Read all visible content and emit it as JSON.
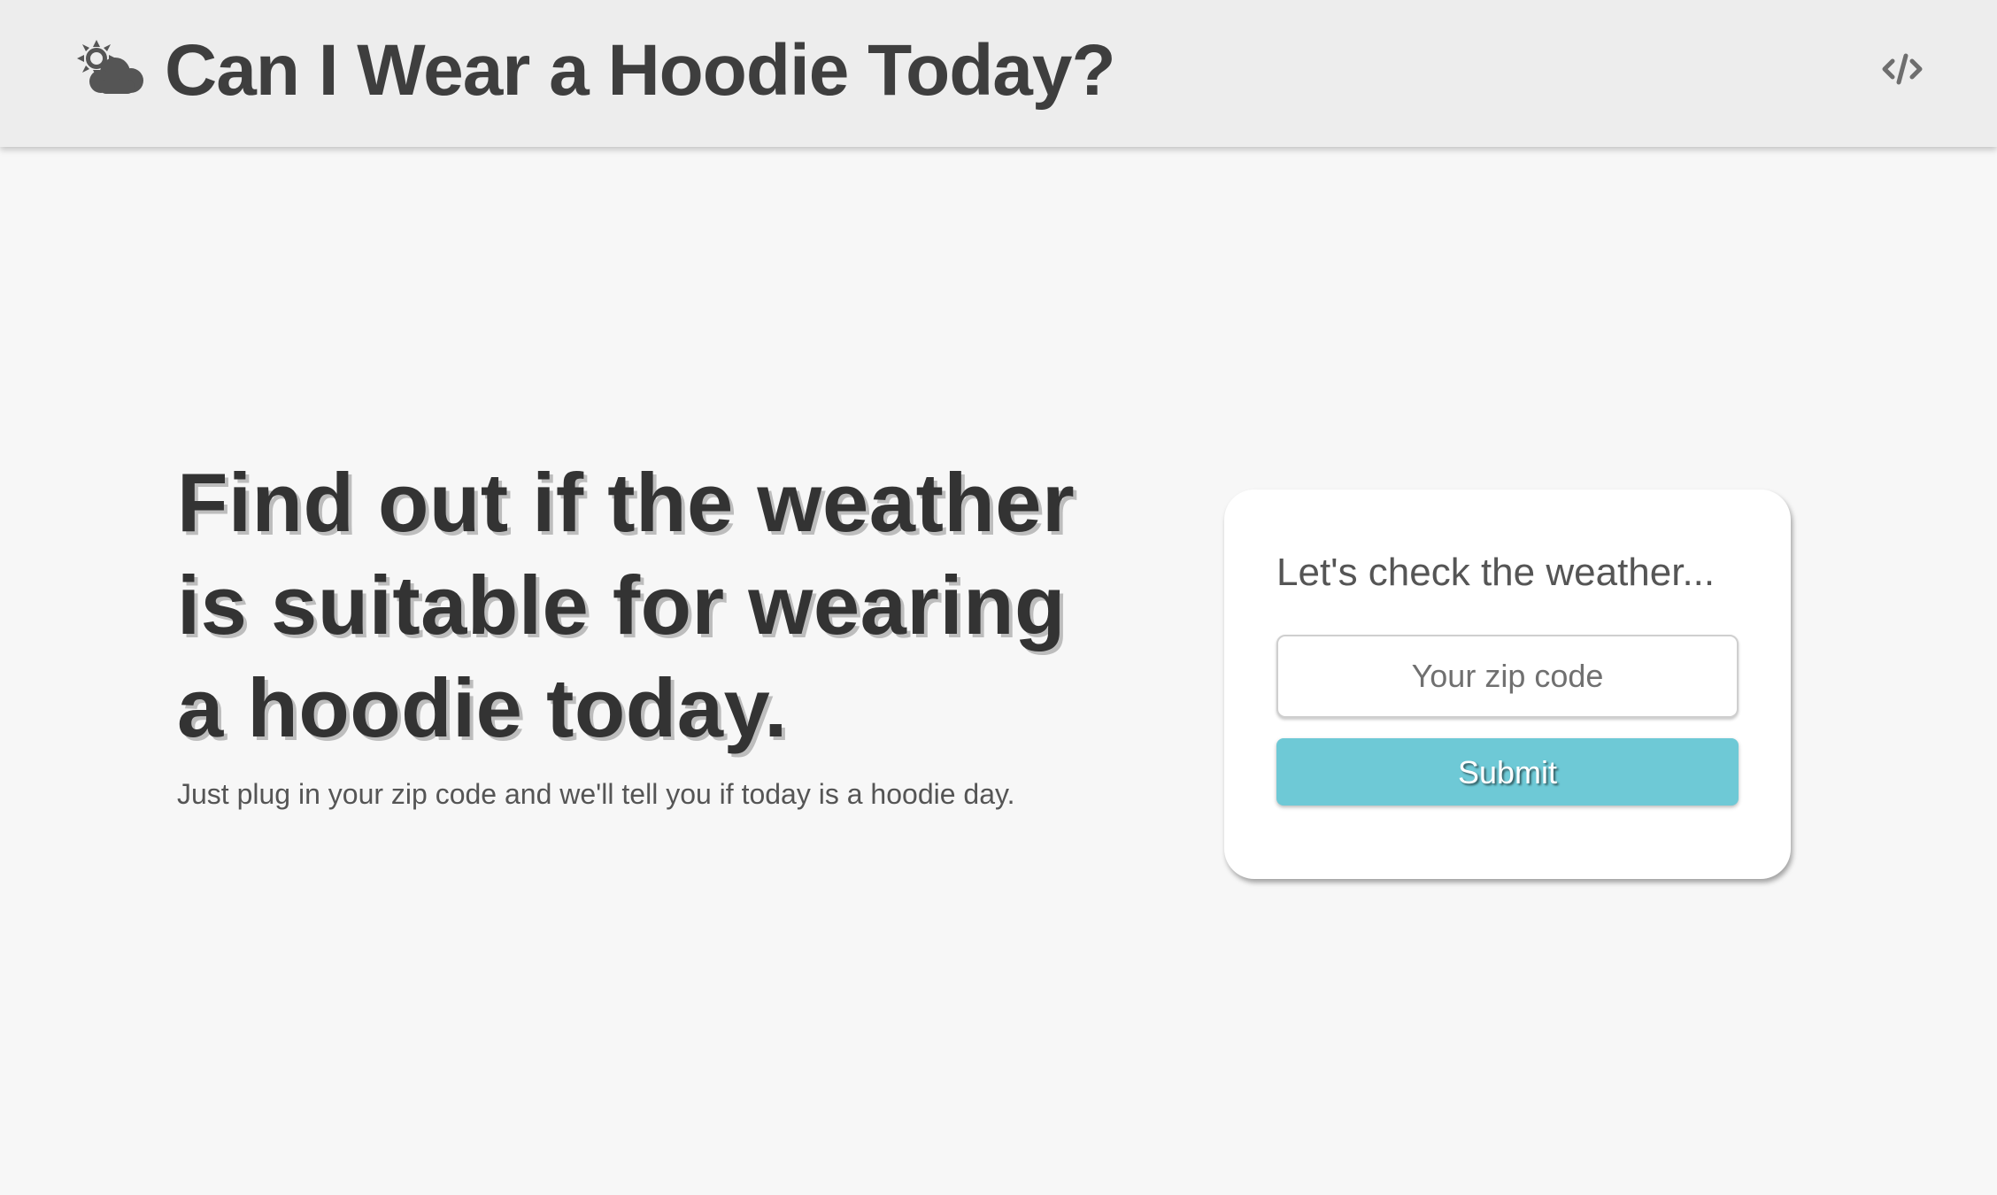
{
  "header": {
    "title": "Can I Wear a Hoodie Today?",
    "logo_icon": "sun-behind-cloud-icon",
    "code_icon": "code-icon"
  },
  "hero": {
    "heading": "Find out if the weather is suitable for wearing a hoodie today.",
    "subtext": "Just plug in your zip code and we'll tell you if today is a hoodie day."
  },
  "form": {
    "title": "Let's check the weather...",
    "zip_placeholder": "Your zip code",
    "zip_value": "",
    "submit_label": "Submit"
  },
  "colors": {
    "header_background": "#ededed",
    "page_background": "#f7f7f7",
    "heading_text": "#333333",
    "submit_button": "#6ec9d6"
  }
}
